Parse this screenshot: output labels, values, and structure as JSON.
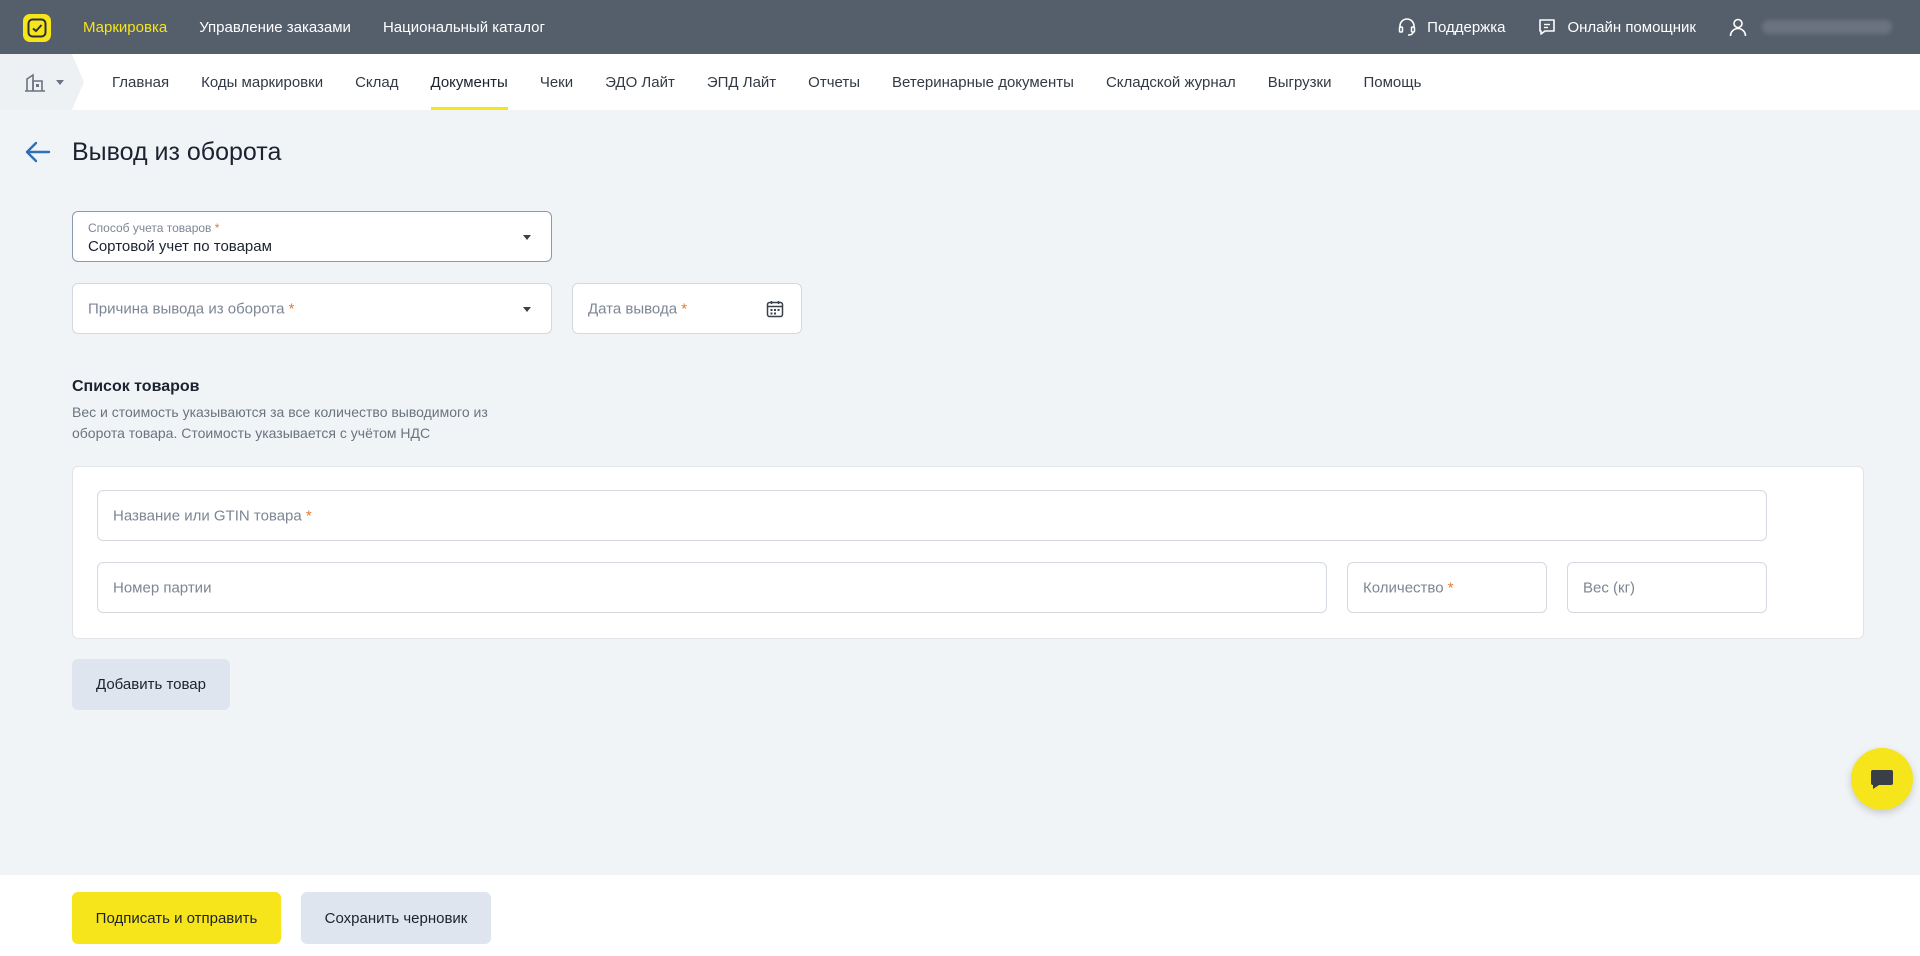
{
  "topbar": {
    "nav": [
      "Маркировка",
      "Управление заказами",
      "Национальный каталог"
    ],
    "support_label": "Поддержка",
    "assistant_label": "Онлайн помощник"
  },
  "subnav": {
    "items": [
      "Главная",
      "Коды маркировки",
      "Склад",
      "Документы",
      "Чеки",
      "ЭДО Лайт",
      "ЭПД Лайт",
      "Отчеты",
      "Ветеринарные документы",
      "Складской журнал",
      "Выгрузки",
      "Помощь"
    ],
    "active_index": 3
  },
  "page": {
    "title": "Вывод из оборота"
  },
  "form": {
    "accounting_method": {
      "label": "Способ учета товаров",
      "value": "Сортовой учет по товарам"
    },
    "reason": {
      "placeholder": "Причина вывода из оборота"
    },
    "date": {
      "placeholder": "Дата вывода"
    },
    "required_mark": "*"
  },
  "goods": {
    "title": "Список товаров",
    "description": "Вес и стоимость указываются за все количество выводимого из оборота товара. Стоимость указывается с учётом НДС",
    "name_field": "Название или GTIN товара",
    "batch_field": "Номер партии",
    "quantity_field": "Количество",
    "weight_field": "Вес (кг)",
    "add_button": "Добавить товар"
  },
  "footer": {
    "sign_button": "Подписать и отправить",
    "draft_button": "Сохранить черновик"
  },
  "colors": {
    "accent": "#f5e51a",
    "topbar": "#555e6b",
    "required": "#e87a2c"
  }
}
